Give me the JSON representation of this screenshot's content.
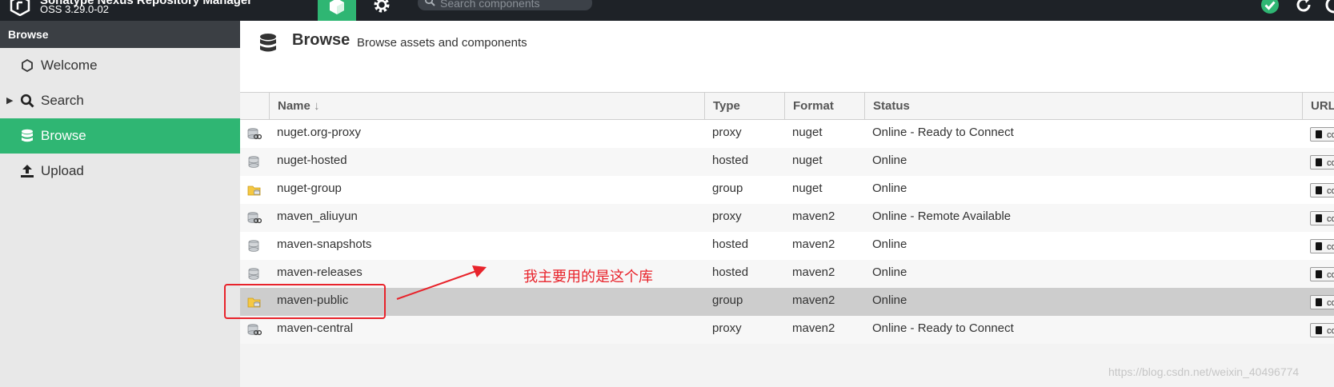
{
  "app": {
    "product_name": "Sonatype Nexus Repository Manager",
    "version": "OSS 3.29.0-02",
    "search_placeholder": "Search components"
  },
  "sidebar": {
    "header": "Browse",
    "items": [
      {
        "label": "Welcome",
        "icon": "hexagon-icon"
      },
      {
        "label": "Search",
        "icon": "search-icon"
      },
      {
        "label": "Browse",
        "icon": "database-icon",
        "active": true
      },
      {
        "label": "Upload",
        "icon": "upload-icon"
      }
    ]
  },
  "page": {
    "title": "Browse",
    "subtitle": "Browse assets and components"
  },
  "table": {
    "columns": {
      "name": "Name",
      "sort_indicator": "↓",
      "type": "Type",
      "format": "Format",
      "status": "Status",
      "url": "URL"
    },
    "copy_label": "copy",
    "rows": [
      {
        "name": "nuget.org-proxy",
        "type": "proxy",
        "format": "nuget",
        "status": "Online - Ready to Connect",
        "icon": "proxy-repo-icon"
      },
      {
        "name": "nuget-hosted",
        "type": "hosted",
        "format": "nuget",
        "status": "Online",
        "icon": "hosted-repo-icon"
      },
      {
        "name": "nuget-group",
        "type": "group",
        "format": "nuget",
        "status": "Online",
        "icon": "group-repo-icon"
      },
      {
        "name": "maven_aliuyun",
        "type": "proxy",
        "format": "maven2",
        "status": "Online - Remote Available",
        "icon": "proxy-repo-icon"
      },
      {
        "name": "maven-snapshots",
        "type": "hosted",
        "format": "maven2",
        "status": "Online",
        "icon": "hosted-repo-icon"
      },
      {
        "name": "maven-releases",
        "type": "hosted",
        "format": "maven2",
        "status": "Online",
        "icon": "hosted-repo-icon"
      },
      {
        "name": "maven-public",
        "type": "group",
        "format": "maven2",
        "status": "Online",
        "icon": "group-repo-icon",
        "selected": true
      },
      {
        "name": "maven-central",
        "type": "proxy",
        "format": "maven2",
        "status": "Online - Ready to Connect",
        "icon": "proxy-repo-icon"
      }
    ]
  },
  "annotation": {
    "note": "我主要用的是这个库",
    "color": "#e8232b"
  },
  "watermark": "https://blog.csdn.net/weixin_40496774",
  "colors": {
    "accent": "#2fb673",
    "topbar": "#1e2227",
    "sidebar_header": "#3b3f44"
  }
}
